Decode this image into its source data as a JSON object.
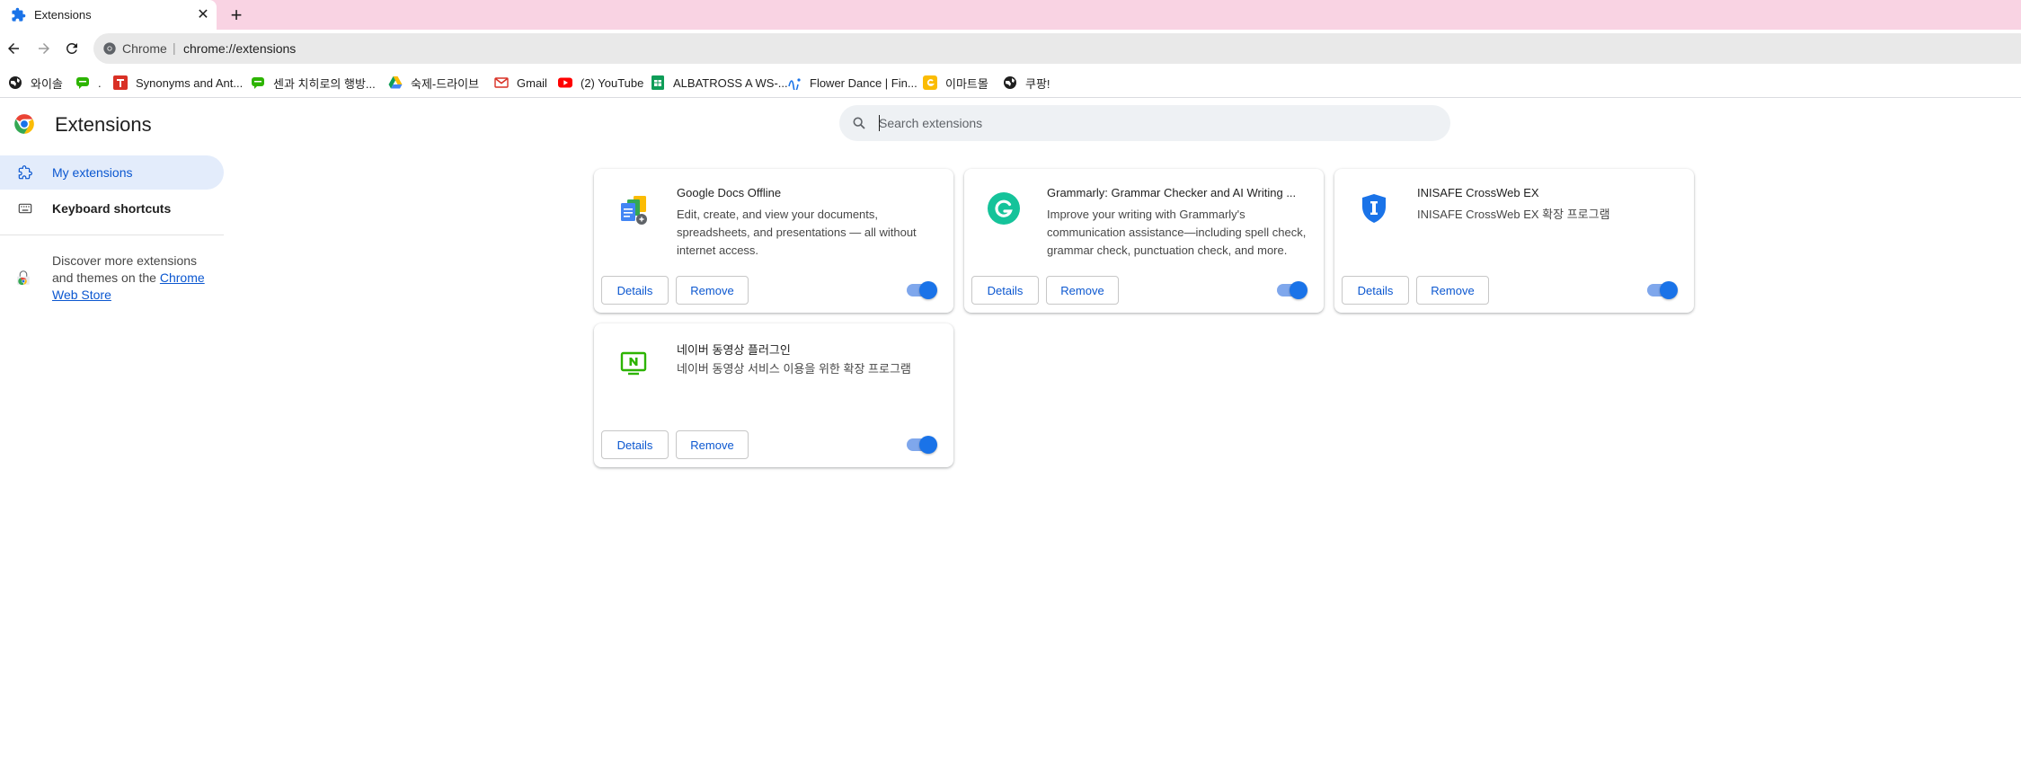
{
  "tab": {
    "title": "Extensions",
    "close_glyph": "✕",
    "new_tab_glyph": "+"
  },
  "omnibox": {
    "site_label": "Chrome",
    "separator": "|",
    "url": "chrome://extensions"
  },
  "bookmarks": [
    {
      "label": "와이솔",
      "icon": "globe-icon"
    },
    {
      "label": ".",
      "icon": "chat-icon"
    },
    {
      "label": "Synonyms and Ant...",
      "icon": "thesaurus-icon"
    },
    {
      "label": "센과 치히로의 행방...",
      "icon": "chat-icon"
    },
    {
      "label": "숙제-드라이브",
      "icon": "drive-icon"
    },
    {
      "label": "Gmail",
      "icon": "gmail-icon"
    },
    {
      "label": "(2) YouTube",
      "icon": "youtube-icon"
    },
    {
      "label": "ALBATROSS A WS-...",
      "icon": "sheets-icon"
    },
    {
      "label": "Flower Dance | Fin...",
      "icon": "music-icon"
    },
    {
      "label": "이마트몰",
      "icon": "emart-icon"
    },
    {
      "label": "쿠팡!",
      "icon": "globe-icon"
    }
  ],
  "page": {
    "title": "Extensions"
  },
  "search": {
    "placeholder": "Search extensions",
    "value": ""
  },
  "sidebar": {
    "items": [
      {
        "label": "My extensions",
        "selected": true
      },
      {
        "label": "Keyboard shortcuts",
        "selected": false
      }
    ],
    "store_text": "Discover more extensions and themes on the ",
    "store_link": "Chrome Web Store"
  },
  "extensions": [
    {
      "name": "Google Docs Offline",
      "description": "Edit, create, and view your documents, spreadsheets, and presentations — all without internet access.",
      "details_label": "Details",
      "remove_label": "Remove",
      "enabled": true,
      "icon": "google-docs-offline-icon"
    },
    {
      "name": "Grammarly: Grammar Checker and AI Writing ...",
      "description": "Improve your writing with Grammarly's communication assistance—including spell check, grammar check, punctuation check, and more.",
      "details_label": "Details",
      "remove_label": "Remove",
      "enabled": true,
      "icon": "grammarly-icon"
    },
    {
      "name": "INISAFE CrossWeb EX",
      "description": "INISAFE CrossWeb EX 확장 프로그램",
      "details_label": "Details",
      "remove_label": "Remove",
      "enabled": true,
      "icon": "inisafe-shield-icon"
    },
    {
      "name": "네이버 동영상 플러그인",
      "description": "네이버 동영상 서비스 이용을 위한 확장 프로그램",
      "details_label": "Details",
      "remove_label": "Remove",
      "enabled": true,
      "icon": "naver-video-icon"
    }
  ],
  "colors": {
    "tabstrip": "#f9d3e3",
    "accent": "#0b57d0",
    "toggle_on": "#1a73e8",
    "sidebar_selected_bg": "#e3ecfb",
    "grammarly": "#15c39a",
    "naver": "#2db400"
  }
}
